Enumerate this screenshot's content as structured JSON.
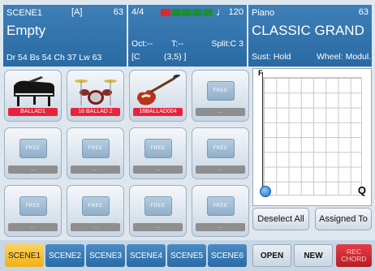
{
  "scene_panel": {
    "title": "SCENE1",
    "bank": "[A]",
    "number": "63",
    "name": "Empty",
    "info": "Dr 54   Bs 54   Ch 37  Lw 63"
  },
  "status_panel": {
    "time_sig": "4/4",
    "meter_colors": [
      "#e02828",
      "#1f8c3a",
      "#1f8c3a",
      "#1f8c3a",
      "#1f8c3a"
    ],
    "note_icon": "quarter-note-icon",
    "tempo": "120",
    "octave": "Oct:--",
    "transpose": "T:--",
    "split": "Split:C 3",
    "chord_root": "[C",
    "chord_value": "(3,5) ]"
  },
  "voice_panel": {
    "category": "Piano",
    "number": "63",
    "name": "CLASSIC GRAND",
    "sustain": "Sust: Hold",
    "wheel": "Wheel: Modul."
  },
  "scenes": [
    {
      "label": "BALLAD1",
      "icon": "grand-piano-icon",
      "filled": true
    },
    {
      "label": "16 BALLAD 2",
      "icon": "drum-kit-icon",
      "filled": true
    },
    {
      "label": "16BALLAD004",
      "icon": "electric-bass-icon",
      "filled": true
    },
    {
      "label": "...",
      "tile": "FREE",
      "filled": false
    },
    {
      "label": "...",
      "tile": "FREE",
      "filled": false
    },
    {
      "label": "...",
      "tile": "FREE",
      "filled": false
    },
    {
      "label": "...",
      "tile": "FREE",
      "filled": false
    },
    {
      "label": "...",
      "tile": "FREE",
      "filled": false
    },
    {
      "label": "...",
      "tile": "FREE",
      "filled": false
    },
    {
      "label": "...",
      "tile": "FREE",
      "filled": false
    },
    {
      "label": "...",
      "tile": "FREE",
      "filled": false
    },
    {
      "label": "...",
      "tile": "FREE",
      "filled": false
    }
  ],
  "graph": {
    "y_label": "F",
    "corner_label": "Q"
  },
  "buttons": {
    "deselect_all": "Deselect All",
    "assigned_to": "Assigned To",
    "open": "OPEN",
    "new": "NEW",
    "rec_line1": "REC",
    "rec_line2": "CHORD"
  },
  "scene_tabs": [
    "SCENE1",
    "SCENE2",
    "SCENE3",
    "SCENE4",
    "SCENE5",
    "SCENE6"
  ],
  "active_tab": 0
}
